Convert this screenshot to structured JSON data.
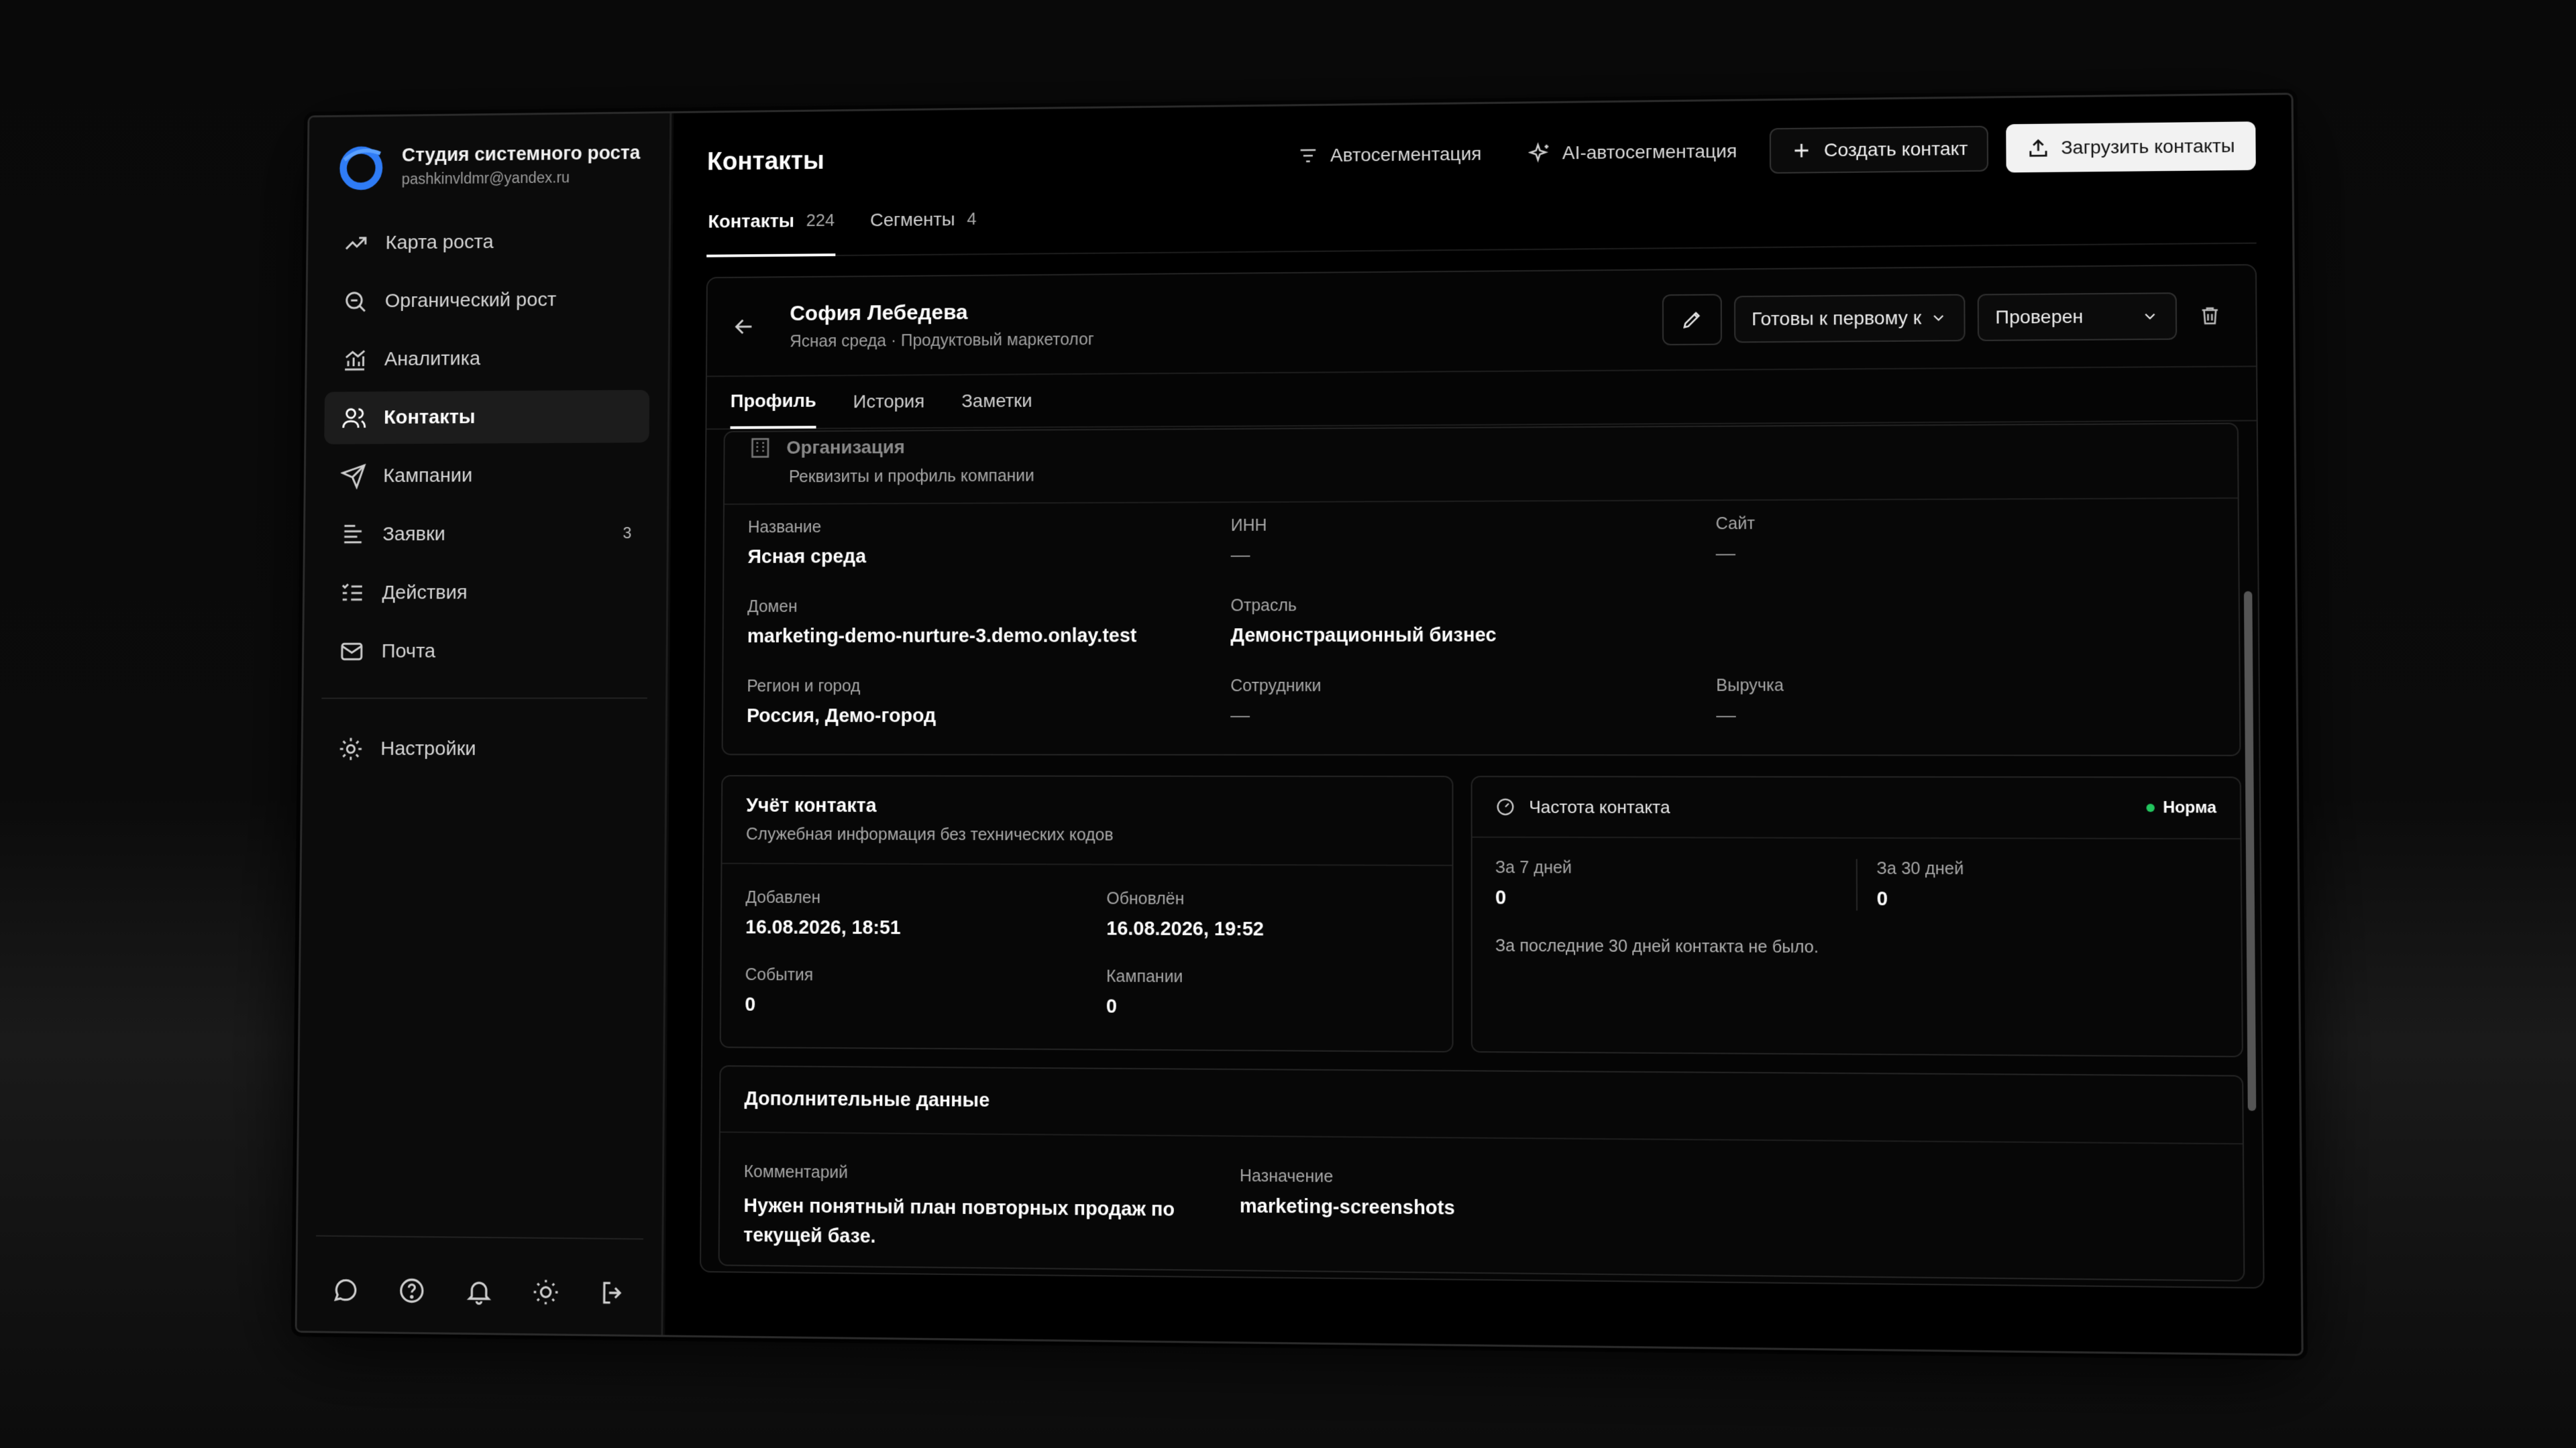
{
  "org": {
    "name": "Студия системного роста",
    "email": "pashkinvldmr@yandex.ru"
  },
  "nav": [
    {
      "label": "Карта роста",
      "icon": "trend-up-icon"
    },
    {
      "label": "Органический рост",
      "icon": "search-icon"
    },
    {
      "label": "Аналитика",
      "icon": "chart-icon"
    },
    {
      "label": "Контакты",
      "icon": "users-icon",
      "active": true
    },
    {
      "label": "Кампании",
      "icon": "send-icon"
    },
    {
      "label": "Заявки",
      "icon": "list-icon",
      "count": "3"
    },
    {
      "label": "Действия",
      "icon": "checklist-icon"
    },
    {
      "label": "Почта",
      "icon": "mail-icon"
    }
  ],
  "settings_label": "Настройки",
  "page": {
    "title": "Контакты"
  },
  "actions": {
    "autoseg": "Автосегментация",
    "ai_autoseg": "AI-автосегментация",
    "create": "Создать контакт",
    "upload": "Загрузить контакты"
  },
  "tabs": [
    {
      "label": "Контакты",
      "count": "224"
    },
    {
      "label": "Сегменты",
      "count": "4"
    }
  ],
  "contact": {
    "name": "София Лебедева",
    "subtitle": "Ясная среда · Продуктовый маркетолог",
    "stage": "Готовы к первому к",
    "status": "Проверен"
  },
  "subtabs": [
    "Профиль",
    "История",
    "Заметки"
  ],
  "organization": {
    "title": "Организация",
    "subtitle": "Реквизиты и профиль компании",
    "fields": [
      {
        "label": "Название",
        "value": "Ясная среда"
      },
      {
        "label": "ИНН",
        "value": "—"
      },
      {
        "label": "Сайт",
        "value": "—"
      },
      {
        "label": "Домен",
        "value": "marketing-demo-nurture-3.demo.onlay.test"
      },
      {
        "label": "Отрасль",
        "value": "Демонстрационный бизнес"
      },
      {
        "label": "",
        "value": ""
      },
      {
        "label": "Регион и город",
        "value": "Россия, Демо-город"
      },
      {
        "label": "Сотрудники",
        "value": "—"
      },
      {
        "label": "Выручка",
        "value": "—"
      }
    ]
  },
  "account": {
    "title": "Учёт контакта",
    "subtitle": "Служебная информация без технических кодов",
    "fields": [
      {
        "label": "Добавлен",
        "value": "16.08.2026, 18:51"
      },
      {
        "label": "Обновлён",
        "value": "16.08.2026, 19:52"
      },
      {
        "label": "События",
        "value": "0"
      },
      {
        "label": "Кампании",
        "value": "0"
      }
    ]
  },
  "frequency": {
    "title": "Частота контакта",
    "badge": "Норма",
    "badge_color": "#22c55e",
    "week_label": "За 7 дней",
    "week_value": "0",
    "month_label": "За 30 дней",
    "month_value": "0",
    "note": "За последние 30 дней контакта не было."
  },
  "extra": {
    "title": "Дополнительные данные",
    "comment_label": "Комментарий",
    "comment": "Нужен понятный план повторных продаж по текущей базе.",
    "purpose_label": "Назначение",
    "purpose": "marketing-screenshots"
  }
}
